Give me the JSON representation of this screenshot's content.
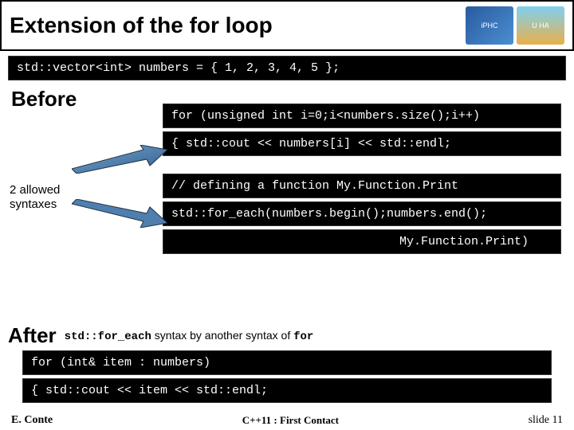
{
  "title": "Extension of the for loop",
  "logos": {
    "iphc": "iPHC",
    "uha": "U HA"
  },
  "code_decl": "std::vector<int> numbers = { 1, 2, 3, 4, 5 };",
  "before_heading": "Before",
  "label_syntaxes": "2 allowed syntaxes",
  "code_for_classic": "for (unsigned int i=0;i<numbers.size();i++)",
  "code_cout_i": "{ std::cout << numbers[i] << std::endl;",
  "code_comment": "// defining a function My.Function.Print",
  "code_foreach": "std::for_each(numbers.begin();numbers.end();",
  "code_foreach_tail": "My.Function.Print)",
  "after_heading": "After",
  "after_text_1a": "std::for_each",
  "after_text_1b": " syntax by another syntax of ",
  "after_text_1c": "for",
  "code_range_for": "for (int& item : numbers)",
  "code_cout_item": "{ std::cout << item << std::endl;",
  "footer": {
    "author": "E. Conte",
    "center": "C++11 : First Contact",
    "slide": "slide 11"
  }
}
